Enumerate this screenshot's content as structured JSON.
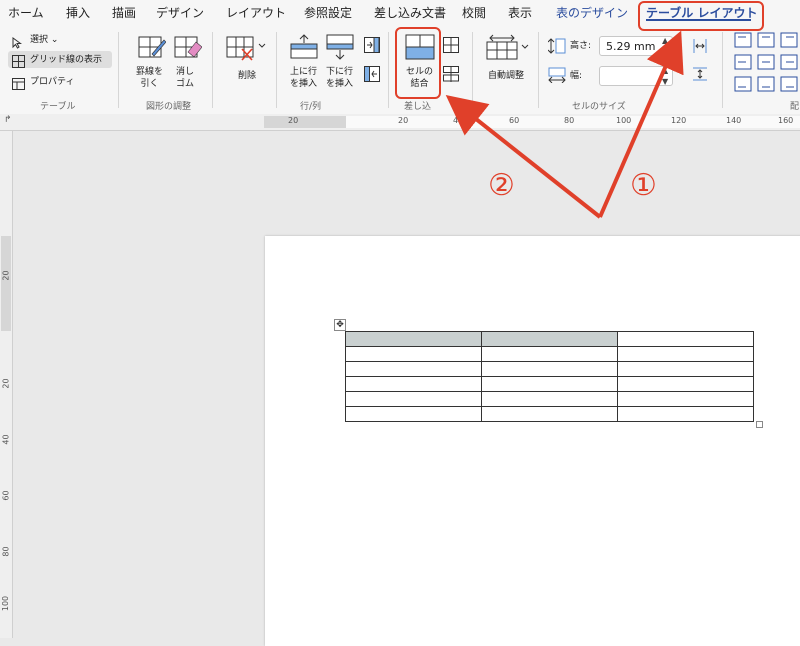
{
  "tabs": [
    {
      "label": "ホーム"
    },
    {
      "label": "挿入"
    },
    {
      "label": "描画"
    },
    {
      "label": "デザイン"
    },
    {
      "label": "レイアウト"
    },
    {
      "label": "参照設定"
    },
    {
      "label": "差し込み文書"
    },
    {
      "label": "校閲"
    },
    {
      "label": "表示"
    },
    {
      "label": "表のデザイン"
    },
    {
      "label": "テーブル レイアウト"
    }
  ],
  "ribbon": {
    "select": "選択",
    "gridlines": "グリッド線の表示",
    "properties": "プロパティ",
    "draw_line": [
      "罫線を",
      "引く"
    ],
    "eraser": [
      "消し",
      "ゴム"
    ],
    "delete": "削除",
    "insert_above": [
      "上に行",
      "を挿入"
    ],
    "insert_below": [
      "下に行",
      "を挿入"
    ],
    "merge_cells": [
      "セルの",
      "結合"
    ],
    "autofit": "自動調整",
    "height_label": "高さ:",
    "height_value": "5.29 mm",
    "width_label": "幅:",
    "groups": {
      "table": "テーブル",
      "draw": "図形の調整",
      "rows_cols": "行/列",
      "merge": "差し込",
      "cell_size": "セルのサイズ",
      "align": "配"
    }
  },
  "ruler": {
    "h": [
      "20",
      "20",
      "40",
      "60",
      "80",
      "100",
      "120",
      "140",
      "160"
    ],
    "v": [
      "20",
      "20",
      "40",
      "60",
      "80",
      "100"
    ]
  },
  "annotations": {
    "step1": "①",
    "step2": "②"
  },
  "colors": {
    "annotation": "#e0402a",
    "active_tab": "#2b4d9e",
    "selected_cell": "#c9d0d0"
  }
}
